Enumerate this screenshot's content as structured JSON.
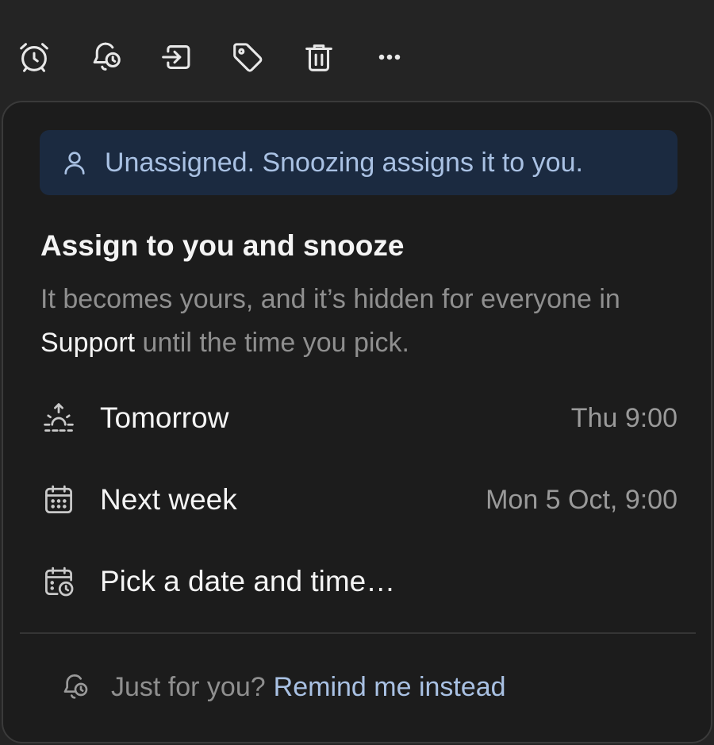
{
  "toolbar": {
    "icons": [
      "alarm-clock-icon",
      "bell-clock-icon",
      "move-to-icon",
      "tag-icon",
      "trash-icon",
      "more-icon"
    ]
  },
  "banner": {
    "icon": "user-icon",
    "text": "Unassigned. Snoozing assigns it to you."
  },
  "heading": "Assign to you and snooze",
  "description": {
    "part1": "It becomes yours, and it’s hidden for everyone in",
    "team": "Support",
    "part2": "until the time you pick."
  },
  "options": [
    {
      "icon": "sunrise-icon",
      "label": "Tomorrow",
      "time": "Thu 9:00"
    },
    {
      "icon": "calendar-icon",
      "label": "Next week",
      "time": "Mon 5 Oct, 9:00"
    },
    {
      "icon": "calendar-clock-icon",
      "label": "Pick a date and time…",
      "time": ""
    }
  ],
  "footer": {
    "icon": "bell-clock-icon",
    "text": "Just for you?",
    "link": "Remind me instead"
  },
  "colors": {
    "background": "#242424",
    "popover": "#1c1c1c",
    "banner_bg": "#1b2a40",
    "accent": "#a9c1e3"
  }
}
